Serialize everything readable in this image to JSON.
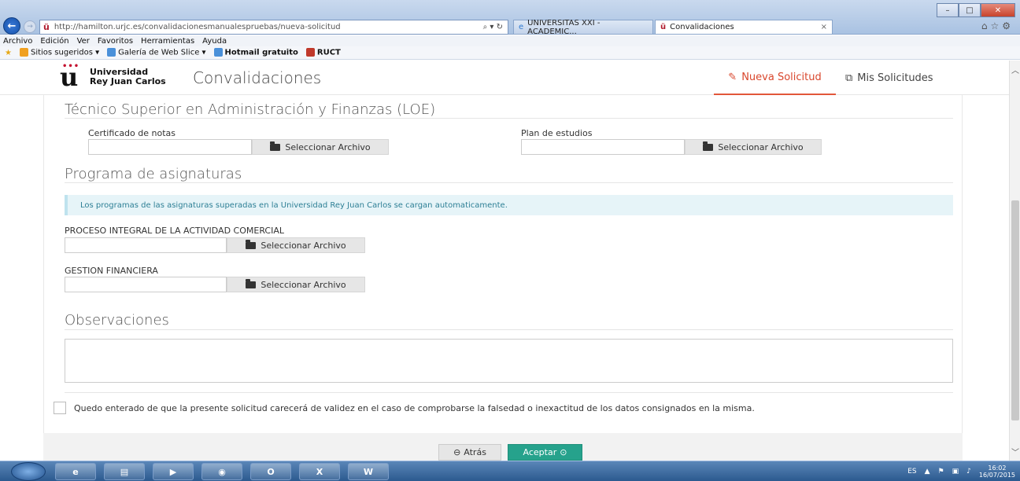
{
  "browser": {
    "url": "http://hamilton.urjc.es/convalidacionesmanualespruebas/nueva-solicitud",
    "url_tools": "⌕ ▾ ↻",
    "tabs": [
      {
        "label": "UNIVERSITAS XXI - ACADEMIC..."
      },
      {
        "label": "Convalidaciones",
        "close": "×"
      }
    ],
    "menu": [
      "Archivo",
      "Edición",
      "Ver",
      "Favoritos",
      "Herramientas",
      "Ayuda"
    ],
    "favorites": [
      "Sitios sugeridos ▾",
      "Galería de Web Slice ▾",
      "Hotmail gratuito",
      "RUCT"
    ],
    "window_controls": {
      "minimize": "–",
      "maximize": "□",
      "close": "✕"
    }
  },
  "header": {
    "logo_line1": "Universidad",
    "logo_line2": "Rey Juan Carlos",
    "app_title": "Convalidaciones",
    "nav_new": "Nueva Solicitud",
    "nav_mine": "Mis Solicitudes"
  },
  "degree": {
    "title": "Técnico Superior en Administración y Finanzas (LOE)",
    "certificado_label": "Certificado de notas",
    "plan_label": "Plan de estudios",
    "select_file": "Seleccionar Archivo"
  },
  "programa": {
    "title": "Programa de asignaturas",
    "info": "Los programas de las asignaturas superadas en la Universidad Rey Juan Carlos se cargan automaticamente.",
    "subjects": [
      {
        "name": "PROCESO INTEGRAL DE LA ACTIVIDAD COMERCIAL"
      },
      {
        "name": "GESTION FINANCIERA"
      }
    ]
  },
  "observaciones": {
    "title": "Observaciones"
  },
  "disclaimer": "Quedo enterado de que la presente solicitud carecerá de validez en el caso de comprobarse la falsedad o inexactitud de los datos consignados en la misma.",
  "actions": {
    "back": "Atrás",
    "accept": "Aceptar"
  },
  "taskbar": {
    "apps": [
      "e",
      "▤",
      "▶",
      "◉",
      "O",
      "X",
      "W"
    ],
    "lang": "ES",
    "time": "16:02",
    "date": "16/07/2015"
  },
  "colors": {
    "accent_orange": "#d9472d",
    "accept_green": "#26a28c",
    "info_bg": "#e6f4f8",
    "logo_red": "#c41230"
  }
}
